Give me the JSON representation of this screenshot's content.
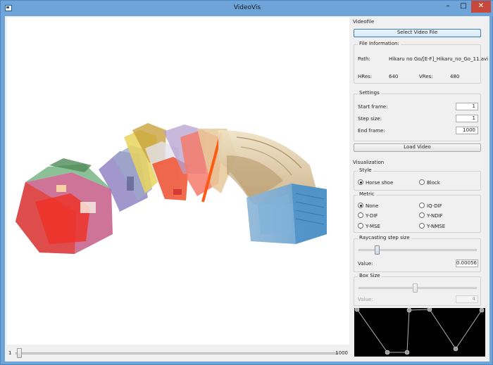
{
  "window": {
    "title": "VideoVis",
    "minimize_glyph": "–",
    "maximize_glyph": "□",
    "close_glyph": "✕",
    "icon": "app-window-icon"
  },
  "viewport": {
    "frame_slider": {
      "min_label": "1",
      "max_label": "1000",
      "value": 1,
      "min": 1,
      "max": 1000
    }
  },
  "videofile": {
    "group_title": "Videofile",
    "select_button": "Select Video File",
    "file_info": {
      "title": "File Information:",
      "path_label": "Path:",
      "path_value": "Hikaru no Go/[E-F]_Hikaru_no_Go_11.avi",
      "hres_label": "HRes:",
      "hres_value": "640",
      "vres_label": "VRes:",
      "vres_value": "480"
    },
    "settings": {
      "title": "Settings",
      "start_label": "Start frame:",
      "start_value": "1",
      "step_label": "Step size:",
      "step_value": "1",
      "end_label": "End frame:",
      "end_value": "1000"
    },
    "load_button": "Load Video"
  },
  "visualization": {
    "group_title": "Visualization",
    "style": {
      "title": "Style",
      "options": [
        "Horse shoe",
        "Block"
      ],
      "selected": "Horse shoe"
    },
    "metric": {
      "title": "Metric",
      "options": [
        "None",
        "IQ-DIF",
        "Y-DIF",
        "Y-NDIF",
        "Y-MSE",
        "Y-NMSE"
      ],
      "selected": "None"
    },
    "raycasting": {
      "title": "Raycasting step size",
      "value_label": "Value:",
      "value": "0.00056",
      "slider_fraction": 0.14
    },
    "box_size": {
      "title": "Box Size",
      "value_label": "Value:",
      "value": "4",
      "slider_fraction": 0.48
    }
  },
  "colors": {
    "titlebar": "#6fa4d9",
    "close_button": "#c7483c",
    "panel_bg": "#f0f0f0",
    "transfer_bg": "#000000",
    "transfer_line": "#b0b0b0"
  }
}
